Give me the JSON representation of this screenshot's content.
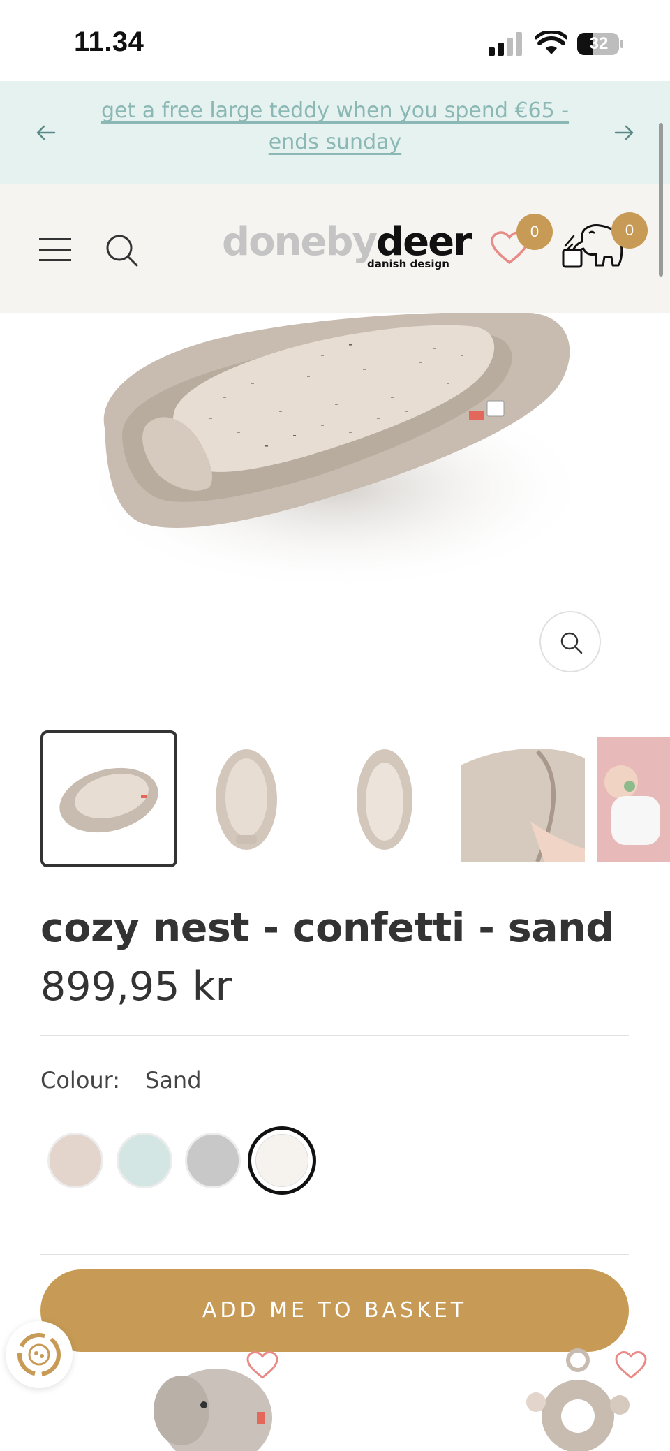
{
  "status_bar": {
    "time": "11.34",
    "battery": "32"
  },
  "promo": {
    "text": "get a free large teddy when you spend €65 - ends sunday",
    "prev_icon": "arrow-left-icon",
    "next_icon": "arrow-right-icon"
  },
  "header": {
    "logo_light": "doneby",
    "logo_dark": "deer",
    "logo_sub": "danish design",
    "wishlist_count": "0",
    "cart_count": "0"
  },
  "product": {
    "title": "cozy nest - confetti - sand",
    "price": "899,95 kr",
    "colour_label": "Colour:",
    "colour_value": "Sand",
    "swatches": [
      {
        "name": "powder",
        "color": "#e3d4cc"
      },
      {
        "name": "blue",
        "color": "#d4e6e3"
      },
      {
        "name": "grey",
        "color": "#c8c8c8"
      },
      {
        "name": "sand",
        "color": "#f6f3ef"
      }
    ],
    "add_to_basket": "ADD ME TO BASKET"
  },
  "colors": {
    "accent": "#c79b55",
    "promo_bg": "#e6f2f0",
    "header_bg": "#f6f4f0",
    "heart": "#e88a86"
  }
}
